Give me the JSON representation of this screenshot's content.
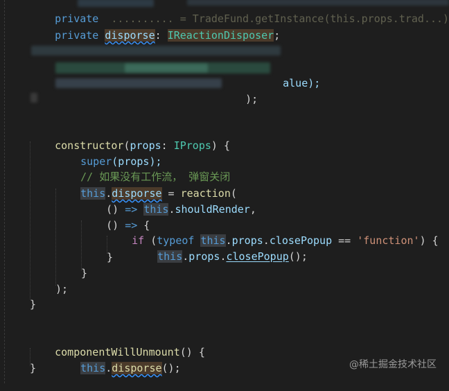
{
  "lines": {
    "l1": {
      "kw": "private",
      "rest": "  .......... = TradeFund.getInstance(this.props.trad...);"
    },
    "l2": {
      "kw": "private",
      "name": "disporse",
      "colon": ": ",
      "type": "IReactionDisposer",
      "semi": ";"
    },
    "l3": {
      "tail": "alue);"
    },
    "l4": {
      "tail": ");"
    },
    "ctor": {
      "name": "constructor",
      "open": "(",
      "param": "props",
      "colon": ": ",
      "type": "IProps",
      "close": ") {"
    },
    "super": {
      "kw": "super",
      "args": "(props);"
    },
    "comment": "// 如果没有工作流， 弹窗关闭",
    "assign": {
      "this": "this",
      "dot": ".",
      "name": "disporse",
      "eq": " = ",
      "fn": "reaction",
      "open": "("
    },
    "arrow1": {
      "pre": "() ",
      "arrow": "=>",
      "sp": " ",
      "this": "this",
      "dot": ".",
      "prop": "shouldRender",
      "end": ","
    },
    "arrow2": {
      "pre": "() ",
      "arrow": "=>",
      "end": " {"
    },
    "if": {
      "kw": "if",
      "open": " (",
      "typeof": "typeof",
      "sp": " ",
      "this": "this",
      "dot": ".",
      "p1": "props",
      "dot2": ".",
      "p2": "closePopup",
      "eq": " == ",
      "str": "'function'",
      "close": ") {"
    },
    "call": {
      "this": "this",
      "dot": ".",
      "p1": "props",
      "dot2": ".",
      "fn": "closePopup",
      "end": "();"
    },
    "brace1": "}",
    "brace2": "}",
    "closeParen": ");",
    "ctorClose": "}",
    "unmount": {
      "name": "componentWillUnmount",
      "end": "() {"
    },
    "dispCall": {
      "this": "this",
      "dot": ".",
      "fn": "disporse",
      "end": "();"
    },
    "unmountClose": "}"
  },
  "watermark": "@稀土掘金技术社区"
}
